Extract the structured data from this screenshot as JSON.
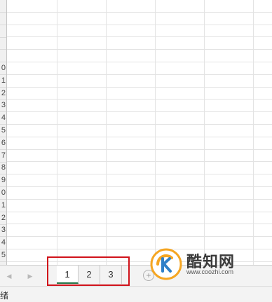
{
  "sheet": {
    "row_numbers": [
      "",
      "",
      "",
      "",
      "",
      "0",
      "1",
      "2",
      "3",
      "4",
      "5",
      "6",
      "7",
      "8",
      "9",
      "0",
      "1",
      "2",
      "3",
      "4",
      "5"
    ]
  },
  "tabbar": {
    "prev_icon": "triangle-left-icon",
    "next_icon": "triangle-right-icon",
    "tabs": [
      {
        "label": "1",
        "active": true
      },
      {
        "label": "2",
        "active": false
      },
      {
        "label": "3",
        "active": false
      }
    ],
    "add_sheet_symbol": "+",
    "highlight_color": "#d0121a"
  },
  "status": {
    "text": "绪"
  },
  "watermark": {
    "title": "酷知网",
    "url": "www.coozhi.com",
    "logo_colors": [
      "#f5a623",
      "#2f80c8"
    ]
  }
}
